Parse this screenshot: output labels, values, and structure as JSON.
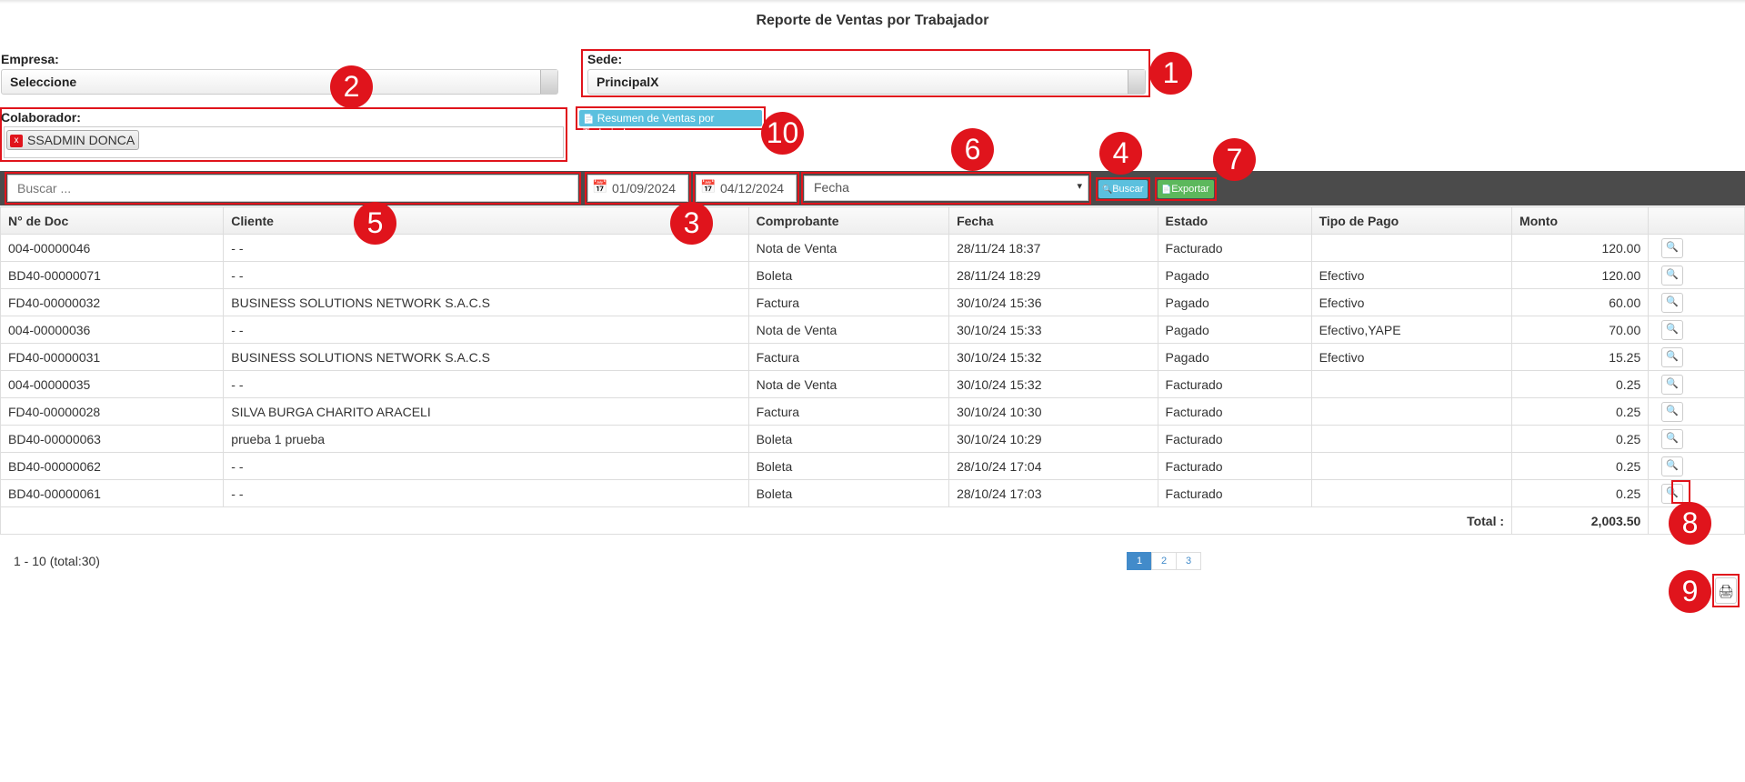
{
  "page": {
    "title": "Reporte de Ventas por Trabajador"
  },
  "filters": {
    "empresa_label": "Empresa:",
    "empresa_value": "Seleccione",
    "sede_label": "Sede:",
    "sede_value": "PrincipalX",
    "colaborador_label": "Colaborador:",
    "colaborador_tag": "SSADMIN DONCA",
    "colaborador_tag_remove": "x",
    "resumen_button": "Resumen de Ventas por Trabajador"
  },
  "toolbar": {
    "search_placeholder": "Buscar ...",
    "date_from": "01/09/2024",
    "date_to": "04/12/2024",
    "order_select": "Fecha",
    "buscar_button": "Buscar",
    "exportar_button": "Exportar"
  },
  "table": {
    "headers": [
      "N° de Doc",
      "Cliente",
      "Comprobante",
      "Fecha",
      "Estado",
      "Tipo de Pago",
      "Monto"
    ],
    "rows": [
      [
        "004-00000046",
        "- -",
        "Nota de Venta",
        "28/11/24 18:37",
        "Facturado",
        "",
        "120.00"
      ],
      [
        "BD40-00000071",
        "- -",
        "Boleta",
        "28/11/24 18:29",
        "Pagado",
        "Efectivo",
        "120.00"
      ],
      [
        "FD40-00000032",
        "BUSINESS SOLUTIONS NETWORK S.A.C.S",
        "Factura",
        "30/10/24 15:36",
        "Pagado",
        "Efectivo",
        "60.00"
      ],
      [
        "004-00000036",
        "- -",
        "Nota de Venta",
        "30/10/24 15:33",
        "Pagado",
        "Efectivo,YAPE",
        "70.00"
      ],
      [
        "FD40-00000031",
        "BUSINESS SOLUTIONS NETWORK S.A.C.S",
        "Factura",
        "30/10/24 15:32",
        "Pagado",
        "Efectivo",
        "15.25"
      ],
      [
        "004-00000035",
        "- -",
        "Nota de Venta",
        "30/10/24 15:32",
        "Facturado",
        "",
        "0.25"
      ],
      [
        "FD40-00000028",
        "SILVA BURGA CHARITO ARACELI",
        "Factura",
        "30/10/24 10:30",
        "Facturado",
        "",
        "0.25"
      ],
      [
        "BD40-00000063",
        "prueba 1 prueba",
        "Boleta",
        "30/10/24 10:29",
        "Facturado",
        "",
        "0.25"
      ],
      [
        "BD40-00000062",
        "- -",
        "Boleta",
        "28/10/24 17:04",
        "Facturado",
        "",
        "0.25"
      ],
      [
        "BD40-00000061",
        "- -",
        "Boleta",
        "28/10/24 17:03",
        "Facturado",
        "",
        "0.25"
      ]
    ],
    "total_label": "Total :",
    "total_value": "2,003.50"
  },
  "pagination": {
    "summary": "1 - 10 (total:30)",
    "pages": [
      "1",
      "2",
      "3"
    ],
    "active": "1"
  },
  "annotations": [
    "1",
    "2",
    "3",
    "4",
    "5",
    "6",
    "7",
    "8",
    "9",
    "10"
  ],
  "icons": {
    "calendar": "calendar-icon",
    "search": "magnifier-icon",
    "print": "printer-icon",
    "doc": "document-icon",
    "excel": "excel-icon"
  },
  "colors": {
    "annotation_red": "#e0141c",
    "toolbar_bg": "#4b4b4b",
    "buscar_bg": "#5bc0de",
    "exportar_bg": "#5cb85c",
    "pager_active": "#428bca"
  }
}
